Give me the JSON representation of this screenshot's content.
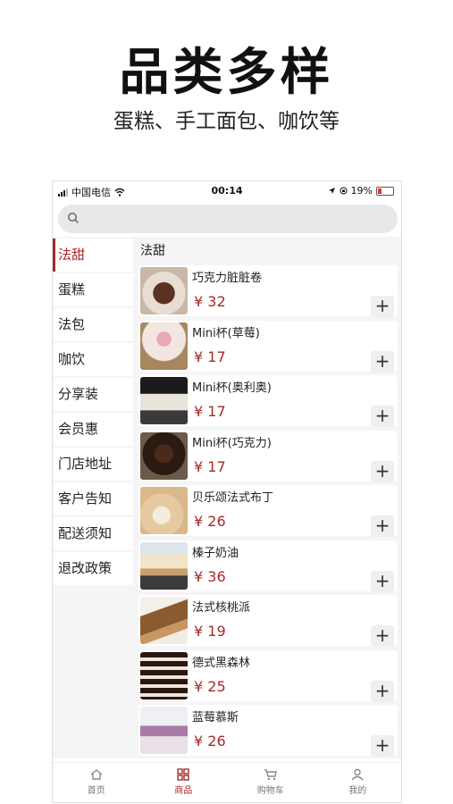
{
  "headline": "品类多样",
  "subline": "蛋糕、手工面包、咖饮等",
  "status_bar": {
    "carrier": "中国电信",
    "time": "00:14",
    "battery": "19%"
  },
  "search": {
    "placeholder": ""
  },
  "sidebar": {
    "active_index": 0,
    "items": [
      {
        "label": "法甜"
      },
      {
        "label": "蛋糕"
      },
      {
        "label": "法包"
      },
      {
        "label": "咖饮"
      },
      {
        "label": "分享装"
      },
      {
        "label": "会员惠"
      },
      {
        "label": "门店地址"
      },
      {
        "label": "客户告知"
      },
      {
        "label": "配送须知"
      },
      {
        "label": "退改政策"
      }
    ]
  },
  "section_title": "法甜",
  "products": [
    {
      "name": "巧克力脏脏卷",
      "price": "¥ 32",
      "add": "+"
    },
    {
      "name": "Mini杯(草莓)",
      "price": "¥ 17",
      "add": "+"
    },
    {
      "name": "Mini杯(奥利奥)",
      "price": "¥ 17",
      "add": "+"
    },
    {
      "name": "Mini杯(巧克力)",
      "price": "¥ 17",
      "add": "+"
    },
    {
      "name": "贝乐颂法式布丁",
      "price": "¥ 26",
      "add": "+"
    },
    {
      "name": "榛子奶油",
      "price": "¥ 36",
      "add": "+"
    },
    {
      "name": "法式核桃派",
      "price": "¥ 19",
      "add": "+"
    },
    {
      "name": "德式黑森林",
      "price": "¥ 25",
      "add": "+"
    },
    {
      "name": "蓝莓慕斯",
      "price": "¥ 26",
      "add": "+"
    }
  ],
  "tabbar": {
    "active_index": 1,
    "tabs": [
      {
        "label": "首页",
        "icon": "home-icon"
      },
      {
        "label": "商品",
        "icon": "grid-icon"
      },
      {
        "label": "购物车",
        "icon": "cart-icon"
      },
      {
        "label": "我的",
        "icon": "user-icon"
      }
    ]
  },
  "colors": {
    "accent": "#a52a2a",
    "background": "#f5f5f5"
  }
}
